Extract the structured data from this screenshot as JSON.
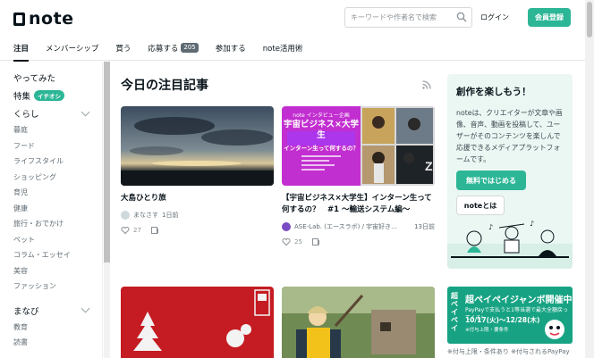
{
  "header": {
    "logo_text": "note",
    "search_placeholder": "キーワードや作者名で検索",
    "login_label": "ログイン",
    "signup_label": "会員登録"
  },
  "tabs": [
    {
      "label": "注目",
      "active": true
    },
    {
      "label": "メンバーシップ"
    },
    {
      "label": "買う"
    },
    {
      "label": "応募する",
      "badge": "205"
    },
    {
      "label": "参加する"
    },
    {
      "label": "note活用術"
    }
  ],
  "sidebar": {
    "try_label": "やってみた",
    "feature_label": "特集",
    "event_badge": "イチオシ",
    "kurashi_label": "くらし",
    "kurashi_items": [
      "暮庭",
      "フード",
      "ライフスタイル",
      "ショッピング",
      "育児",
      "健康",
      "旅行・おでかけ",
      "ペット",
      "コラム・エッセイ",
      "美容",
      "ファッション"
    ],
    "manabi_label": "まなび",
    "manabi_items": [
      "教育",
      "読書"
    ]
  },
  "main": {
    "title": "今日の注目記事",
    "cards": [
      {
        "title": "大島ひとり旅",
        "author": "まなさす",
        "time": "1日前",
        "likes": "27"
      },
      {
        "title": "【宇宙ビジネス×大学生】インターン生って何するの？　#1 〜輸送システム編〜",
        "author": "ASE-Lab. (エースラボ) / 宇宙好き…",
        "time": "13日前",
        "likes": "25",
        "image_heading": "宇宙ビジネス×大学生",
        "image_sub": "インターン生って何するの？",
        "image_caption": "note インタビュー企画"
      }
    ]
  },
  "promo": {
    "title": "創作を楽しもう！",
    "desc": "noteは、クリエイターが文章や画像、音声、動画を投稿して、ユーザーがそのコンテンツを楽しんで応援できるメディアプラットフォームです。",
    "start_label": "無料ではじめる",
    "about_label": "noteとは"
  },
  "paypay": {
    "vertical": "超ペイペイ",
    "title": "超ペイペイジャンボ開催中",
    "sub": "PayPayで支払うと1等当選で最大全額戻ってくる!",
    "date": "10/17(火)〜12/28(木)",
    "note2": "※付与上限・要条件",
    "footer": "※付与上限・条件あり  ※付与されるPayPay"
  },
  "colors": {
    "accent": "#2cb696",
    "text": "#08131a",
    "promo_bg": "#ebf7f3"
  }
}
